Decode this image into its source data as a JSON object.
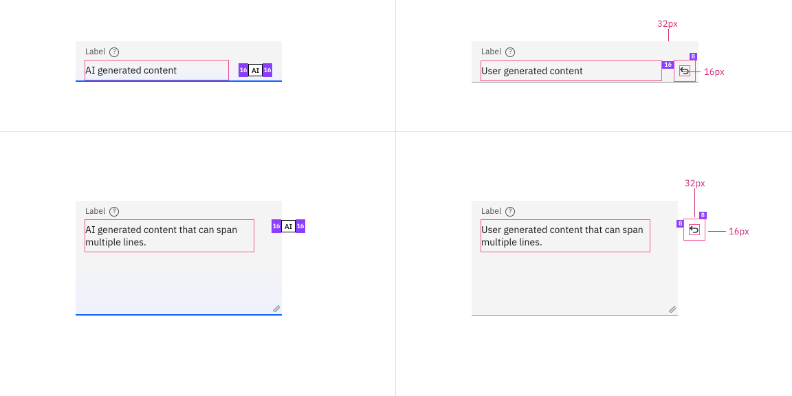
{
  "label": "Label",
  "help_glyph": "?",
  "ai_chip": "AI",
  "spacing": {
    "sixteen": "16",
    "eight": "8"
  },
  "callouts": {
    "w32": "32px",
    "s16": "16px"
  },
  "variants": {
    "tl": {
      "value": "AI generated content"
    },
    "tr": {
      "value": "User generated content"
    },
    "bl": {
      "value": "AI generated content that can span multiple lines."
    },
    "br": {
      "value": "User generated content that can span multiple lines."
    }
  }
}
